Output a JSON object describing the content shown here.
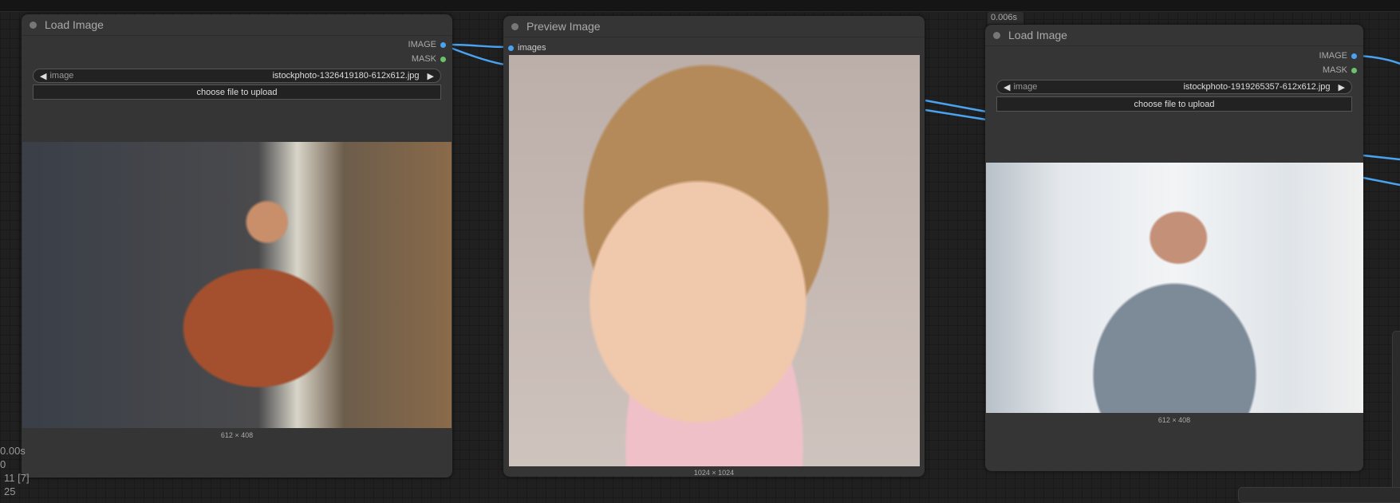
{
  "nodes": [
    {
      "title": "Load Image",
      "outputs": [
        "IMAGE",
        "MASK"
      ],
      "widget_label": "image",
      "widget_value": "istockphoto-1326419180-612x612.jpg",
      "upload_label": "choose file to upload",
      "image_size": "612 × 408"
    },
    {
      "title": "Preview Image",
      "inputs": [
        "images"
      ],
      "image_size": "1024 × 1024"
    },
    {
      "title": "Load Image",
      "timing": "0.006s",
      "outputs": [
        "IMAGE",
        "MASK"
      ],
      "widget_label": "image",
      "widget_value": "istockphoto-1919265357-612x612.jpg",
      "upload_label": "choose file to upload",
      "image_size": "612 × 408"
    }
  ],
  "stats": [
    "0.00s",
    "0",
    "11 [7]",
    "25"
  ],
  "colors": {
    "image_socket": "#4aa3f0",
    "mask_socket": "#6ac36a",
    "wire": "#4aa3f0"
  }
}
